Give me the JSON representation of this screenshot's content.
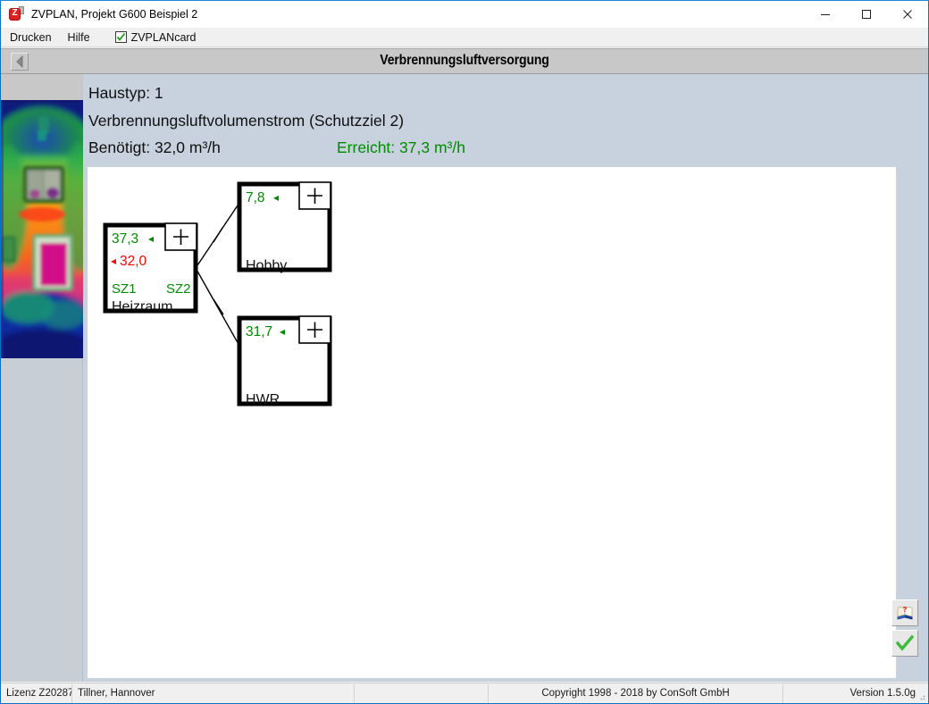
{
  "window": {
    "title": "ZVPLAN, Projekt G600 Beispiel 2",
    "app_icon": "zvplan-app-icon",
    "minimize_label": "—",
    "maximize_label": "□",
    "close_label": "✕"
  },
  "menubar": {
    "items": [
      {
        "label": "Drucken"
      },
      {
        "label": "Hilfe"
      }
    ],
    "checkbox": {
      "label": "ZVPLANcard",
      "checked": true
    }
  },
  "section": {
    "back_button": "back-arrow",
    "title": "Verbrennungsluftversorgung"
  },
  "sidebar": {
    "image_name": "thermal-house-image"
  },
  "info": {
    "haustyp_line": "Haustyp: 1",
    "subtitle": "Verbrennungsluftvolumenstrom (Schutzziel 2)",
    "required_label": "Benötigt: 32,0 m³/h",
    "achieved_label": "Erreicht: 37,3 m³/h"
  },
  "colors": {
    "green": "#008a00",
    "red": "#ff0000",
    "black": "#000000",
    "header_bar": "#c8c8c8",
    "content_bg": "#c7d2de",
    "canvas_bg": "#ffffff"
  },
  "diagram": {
    "nodes": [
      {
        "id": "heizraum",
        "name": "Heizraum",
        "achieved_value": "37,3",
        "achieved_arrow": "◂",
        "required_value": "32,0",
        "required_arrow": "◂",
        "tag_left": "SZ1",
        "tag_right": "SZ2",
        "plus_button": "+"
      },
      {
        "id": "hobby",
        "name": "Hobby",
        "achieved_value": "7,8",
        "achieved_arrow": "◂",
        "plus_button": "+"
      },
      {
        "id": "hwr",
        "name": "HWR",
        "achieved_value": "31,7",
        "achieved_arrow": "◂",
        "plus_button": "+"
      }
    ],
    "connections": [
      {
        "from": "heizraum",
        "to": "hobby"
      },
      {
        "from": "heizraum",
        "to": "hwr"
      }
    ]
  },
  "actions": {
    "help_button": "help-book-icon",
    "confirm_button": "green-check-icon"
  },
  "statusbar": {
    "license": "Lizenz Z20287",
    "owner": "Tillner, Hannover",
    "copyright": "Copyright 1998 - 2018 by ConSoft GmbH",
    "version": "Version 1.5.0g"
  }
}
